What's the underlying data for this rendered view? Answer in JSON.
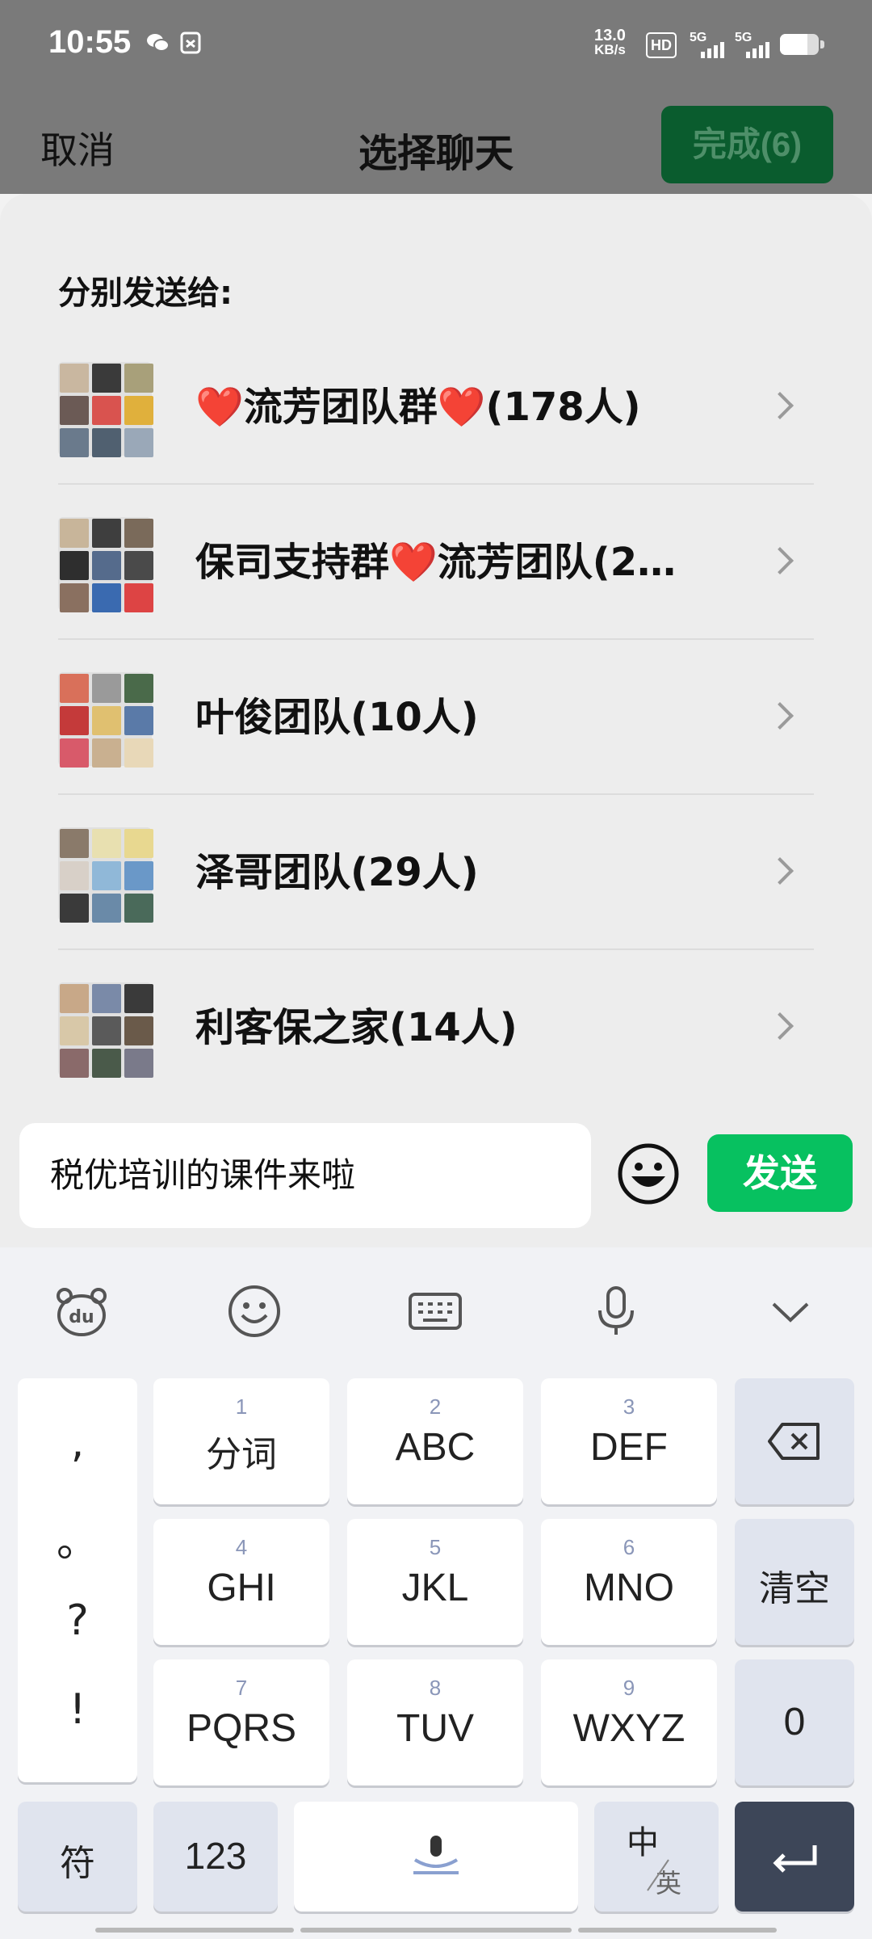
{
  "status_bar": {
    "time": "10:55",
    "net_speed_value": "13.0",
    "net_speed_unit": "KB/s",
    "hd_label": "HD",
    "sim1_label": "5G",
    "sim2_label": "5G",
    "battery_level": 0.7
  },
  "nav": {
    "cancel": "取消",
    "title": "选择聊天",
    "done": "完成(6)"
  },
  "sheet": {
    "send_separately_label": "分别发送给:",
    "chats": [
      {
        "prefix": "❤️",
        "name": "流芳团队群",
        "suffix": "❤️",
        "count": "(178人)"
      },
      {
        "prefix": "",
        "name": "保司支持群",
        "suffix": "❤️",
        "count": "流芳团队(2…"
      },
      {
        "prefix": "",
        "name": "叶俊团队(10人)",
        "suffix": "",
        "count": ""
      },
      {
        "prefix": "",
        "name": "泽哥团队(29人)",
        "suffix": "",
        "count": ""
      },
      {
        "prefix": "",
        "name": "利客保之家(14人)",
        "suffix": "",
        "count": ""
      }
    ]
  },
  "composer": {
    "message": "税优培训的课件来啦",
    "send": "发送"
  },
  "keyboard": {
    "punct": [
      ",",
      "。",
      "?",
      "!"
    ],
    "keys": [
      {
        "num": "1",
        "label": "分词"
      },
      {
        "num": "2",
        "label": "ABC"
      },
      {
        "num": "3",
        "label": "DEF"
      },
      {
        "num": "4",
        "label": "GHI"
      },
      {
        "num": "5",
        "label": "JKL"
      },
      {
        "num": "6",
        "label": "MNO"
      },
      {
        "num": "7",
        "label": "PQRS"
      },
      {
        "num": "8",
        "label": "TUV"
      },
      {
        "num": "9",
        "label": "WXYZ"
      }
    ],
    "clear": "清空",
    "zero": "0",
    "symbols": "符",
    "numbers": "123",
    "lang_top": "中",
    "lang_bottom": "英"
  },
  "colors": {
    "wechat_green": "#07c160",
    "done_button": "#0a5c2e"
  }
}
